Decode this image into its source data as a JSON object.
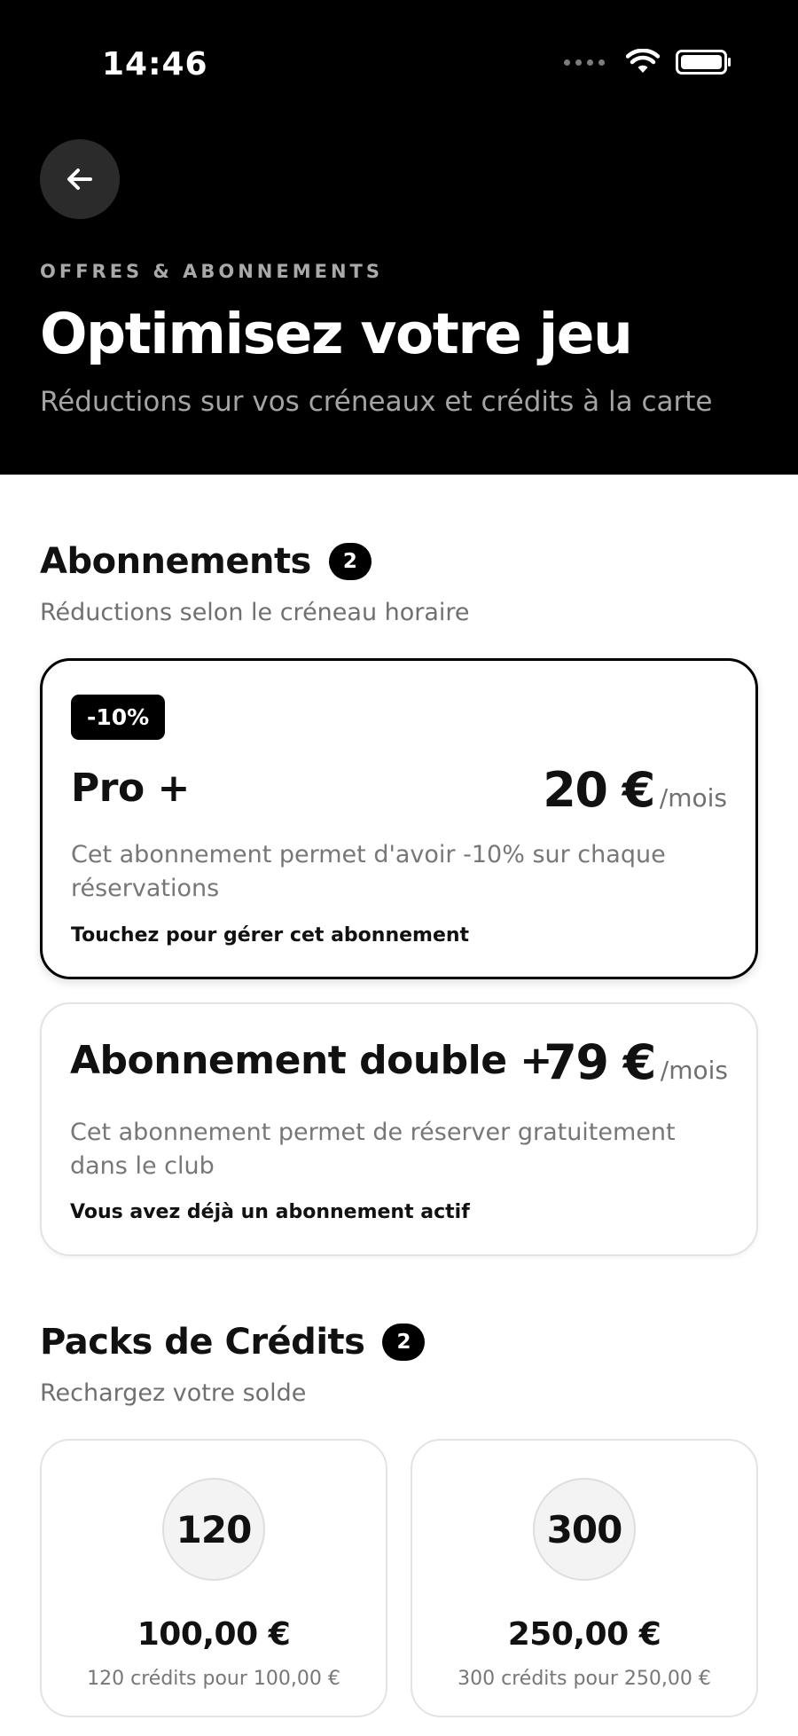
{
  "status_bar": {
    "time": "14:46"
  },
  "header": {
    "eyebrow": "OFFRES & ABONNEMENTS",
    "title": "Optimisez votre jeu",
    "subtitle": "Réductions sur vos créneaux et crédits à la carte"
  },
  "subscriptions": {
    "title": "Abonnements",
    "count": "2",
    "subtitle": "Réductions selon le créneau horaire",
    "items": [
      {
        "badge": "-10%",
        "name": "Pro +",
        "price": "20 €",
        "period": "/mois",
        "description": "Cet abonnement permet d'avoir -10% sur chaque réservations",
        "note": "Touchez pour gérer cet abonnement",
        "active": true
      },
      {
        "name": "Abonnement double +",
        "price": "79 €",
        "period": "/mois",
        "description": "Cet abonnement permet de réserver gratuitement dans le club",
        "note": "Vous avez déjà un abonnement actif",
        "active": false
      }
    ]
  },
  "credit_packs": {
    "title": "Packs de Crédits",
    "count": "2",
    "subtitle": "Rechargez votre solde",
    "items": [
      {
        "credits": "120",
        "price": "100,00 €",
        "description": "120 crédits pour 100,00 €"
      },
      {
        "credits": "300",
        "price": "250,00 €",
        "description": "300 crédits pour 250,00 €"
      }
    ]
  },
  "colors": {
    "header_background": "#000000",
    "accent": "#000000",
    "muted_text": "#777777",
    "card_border": "#e3e3e3"
  }
}
